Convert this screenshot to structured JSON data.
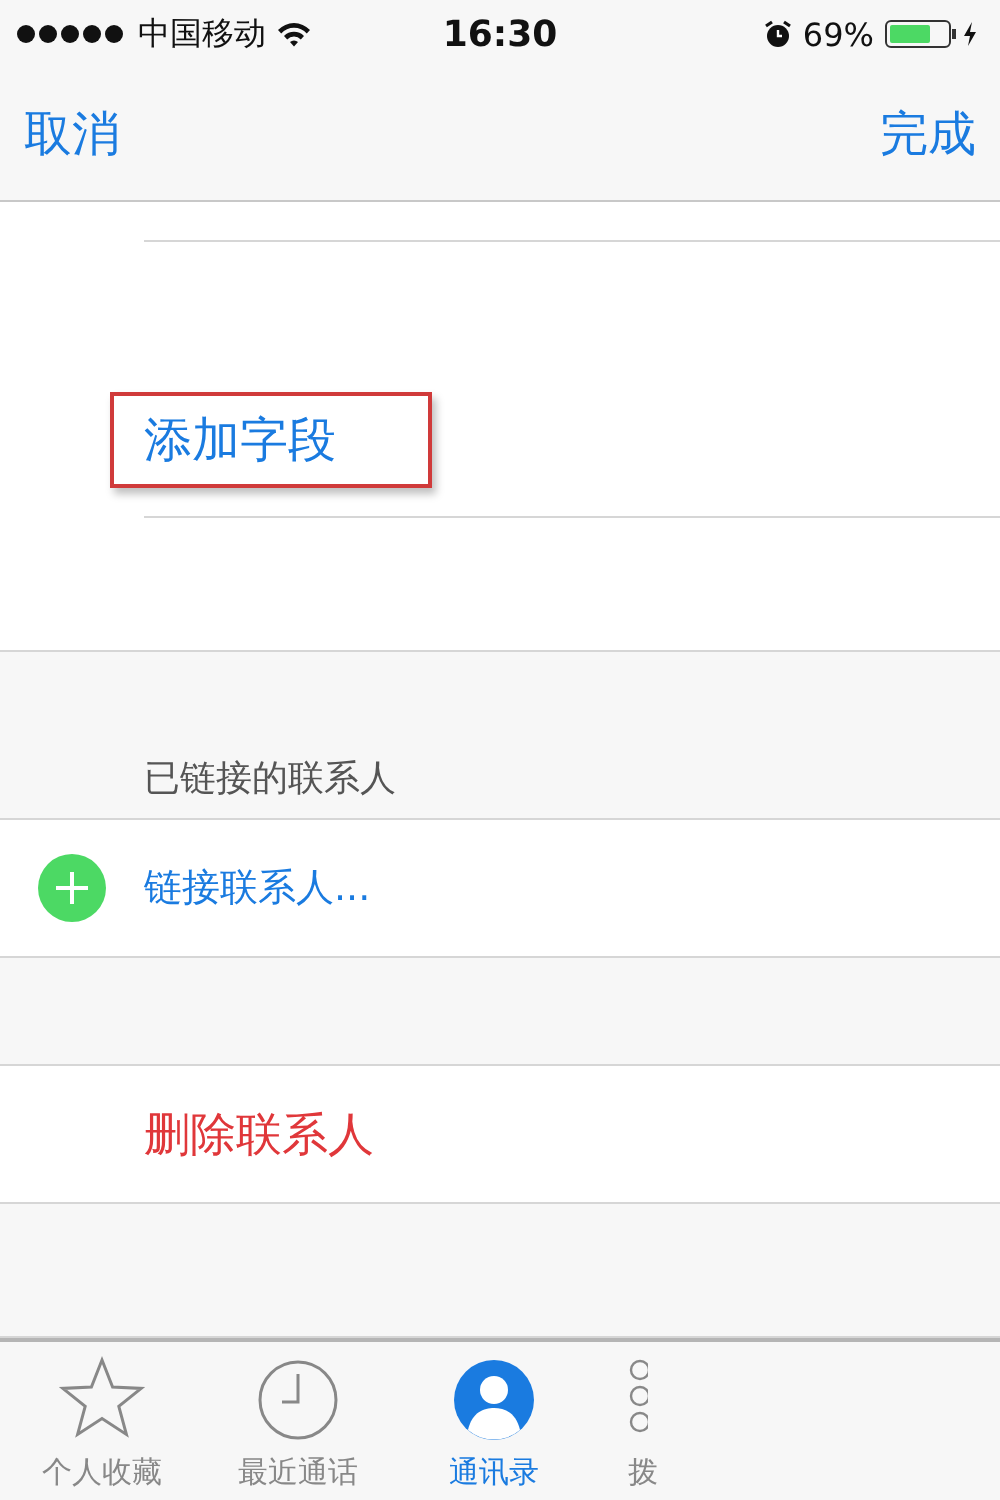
{
  "status_bar": {
    "carrier": "中国移动",
    "time": "16:30",
    "battery": "69%"
  },
  "nav": {
    "left": "取消",
    "right": "完成"
  },
  "add_field": {
    "label": "添加字段",
    "highlighted": true
  },
  "linked_section": {
    "header": "已链接的联系人",
    "action": "链接联系人..."
  },
  "delete_button": "删除联系人",
  "tabs": [
    {
      "label": "个人收藏",
      "kind": "star",
      "selected": false
    },
    {
      "label": "最近通话",
      "kind": "clock",
      "selected": false
    },
    {
      "label": "通讯录",
      "kind": "person",
      "selected": true
    },
    {
      "label": "拨",
      "kind": "keypad",
      "selected": false
    }
  ]
}
